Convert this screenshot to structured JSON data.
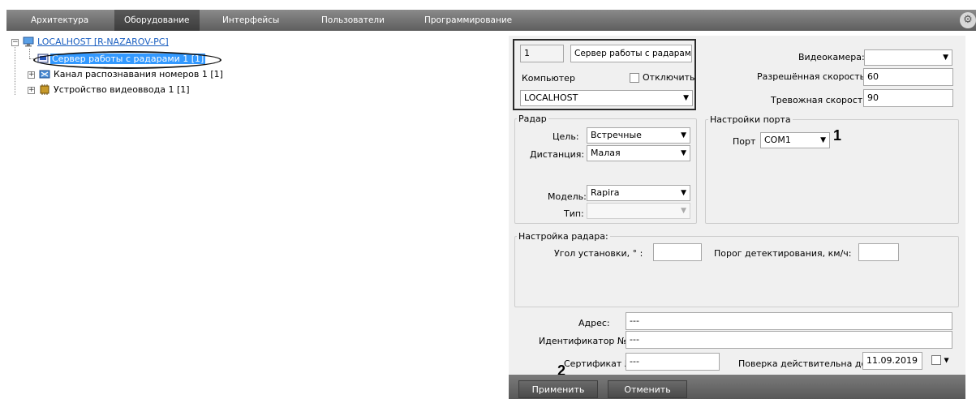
{
  "tabs": [
    {
      "label": "Архитектура"
    },
    {
      "label": "Оборудование"
    },
    {
      "label": "Интерфейсы"
    },
    {
      "label": "Пользователи"
    },
    {
      "label": "Программирование"
    }
  ],
  "tree": {
    "root": "LOCALHOST [R-NAZAROV-PC]",
    "items": [
      {
        "label": "Сервер работы с радарами 1 [1]",
        "icon": "radar-server-icon",
        "selected": true
      },
      {
        "label": "Канал распознавания номеров 1 [1]",
        "icon": "plate-recognition-icon"
      },
      {
        "label": "Устройство видеоввода 1 [1]",
        "icon": "video-capture-icon"
      }
    ]
  },
  "object": {
    "id": "1",
    "name": "Сервер работы с радарами",
    "computer_label": "Компьютер",
    "disable_label": "Отключить",
    "computer_value": "LOCALHOST"
  },
  "camera": {
    "label": "Видеокамера:",
    "value": ""
  },
  "allowed_speed": {
    "label": "Разрешённая скорость:",
    "value": "60"
  },
  "alarm_speed": {
    "label": "Тревожная скорость:",
    "value": "90"
  },
  "radar": {
    "title": "Радар",
    "target_label": "Цель:",
    "target_value": "Встречные",
    "distance_label": "Дистанция:",
    "distance_value": "Малая",
    "model_label": "Модель:",
    "model_value": "Rapira",
    "type_label": "Тип:",
    "type_value": ""
  },
  "port": {
    "title": "Настройки порта",
    "label": "Порт",
    "value": "COM1"
  },
  "radar_setup": {
    "title": "Настройка радара:",
    "angle_label": "Угол установки, ° :",
    "angle_value": "",
    "threshold_label": "Порог детектирования, км/ч:",
    "threshold_value": ""
  },
  "address": {
    "label": "Адрес:",
    "value": "---"
  },
  "identifier": {
    "label": "Идентификатор №:",
    "value": "---"
  },
  "certificate": {
    "label": "Сертификат №:",
    "value": "---"
  },
  "verification": {
    "label": "Поверка действительна до:",
    "value": "11.09.2019"
  },
  "buttons": {
    "apply": "Применить",
    "cancel": "Отменить"
  },
  "annotations": {
    "one": "1",
    "two": "2"
  }
}
